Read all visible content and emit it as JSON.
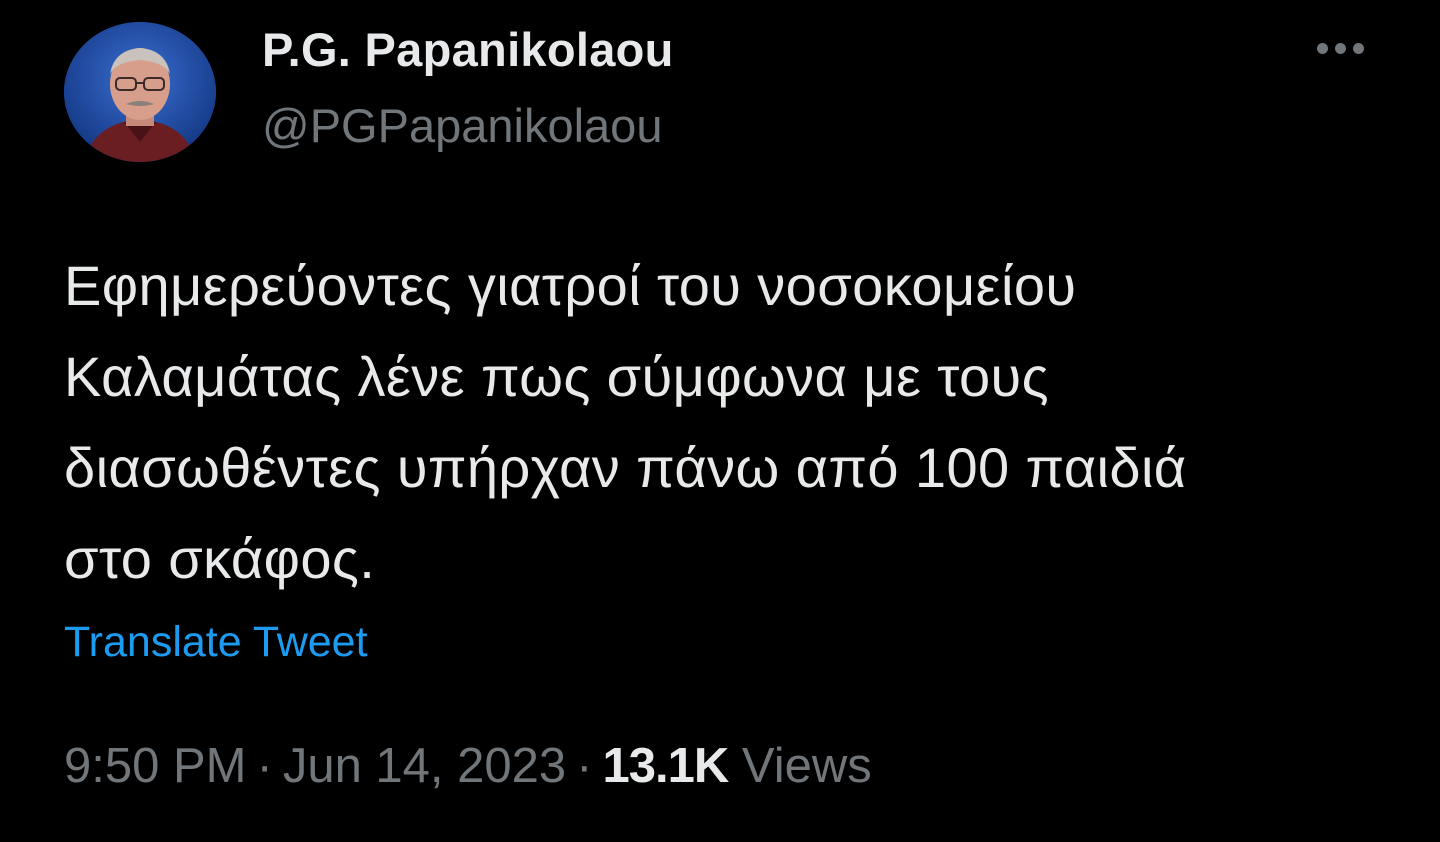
{
  "author": {
    "display_name": "P.G. Papanikolaou",
    "handle": "@PGPapanikolaou",
    "avatar": "avatar"
  },
  "more_icon": "more-horizontal-icon",
  "tweet": {
    "lines": [
      "Εφημερεύοντες γιατροί του νοσοκομείου",
      "Καλαμάτας λένε πως σύμφωνα με τους",
      "διασωθέντες υπήρχαν πάνω από 100 παιδιά",
      "στο σκάφος."
    ]
  },
  "translate_label": "Translate Tweet",
  "meta": {
    "time": "9:50 PM",
    "separator": "·",
    "date": "Jun 14, 2023",
    "views_count": "13.1K",
    "views_label": "Views"
  },
  "colors": {
    "background": "#000000",
    "text": "#e7e9ea",
    "secondary": "#71767b",
    "link": "#1d9bf0"
  }
}
